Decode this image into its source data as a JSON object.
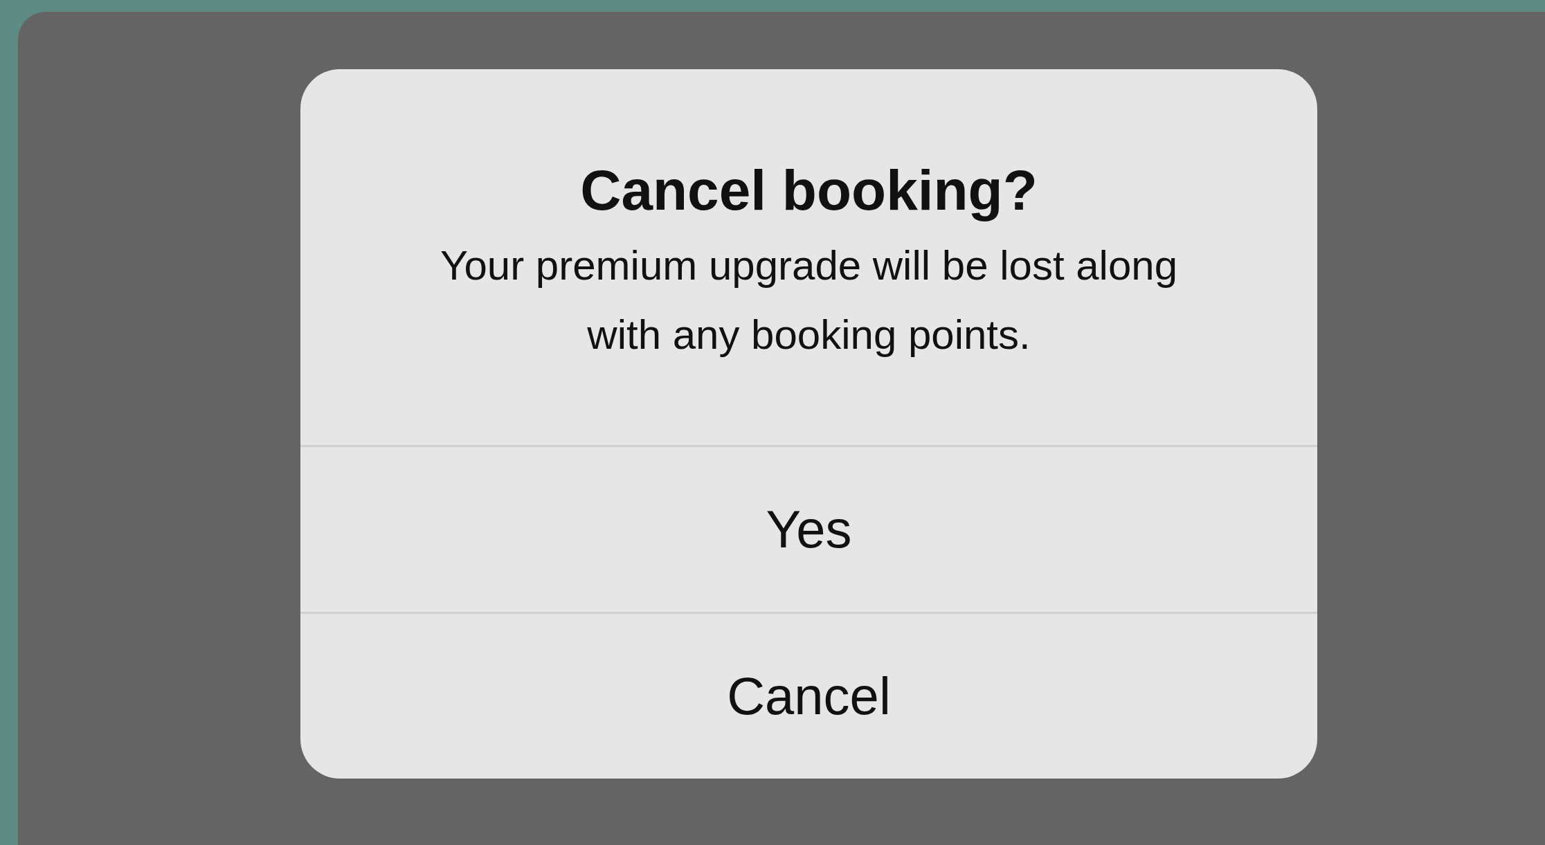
{
  "dialog": {
    "title": "Cancel booking?",
    "message": "Your premium upgrade will be lost along with any booking points.",
    "buttons": [
      {
        "label": "Yes"
      },
      {
        "label": "Cancel"
      }
    ]
  }
}
